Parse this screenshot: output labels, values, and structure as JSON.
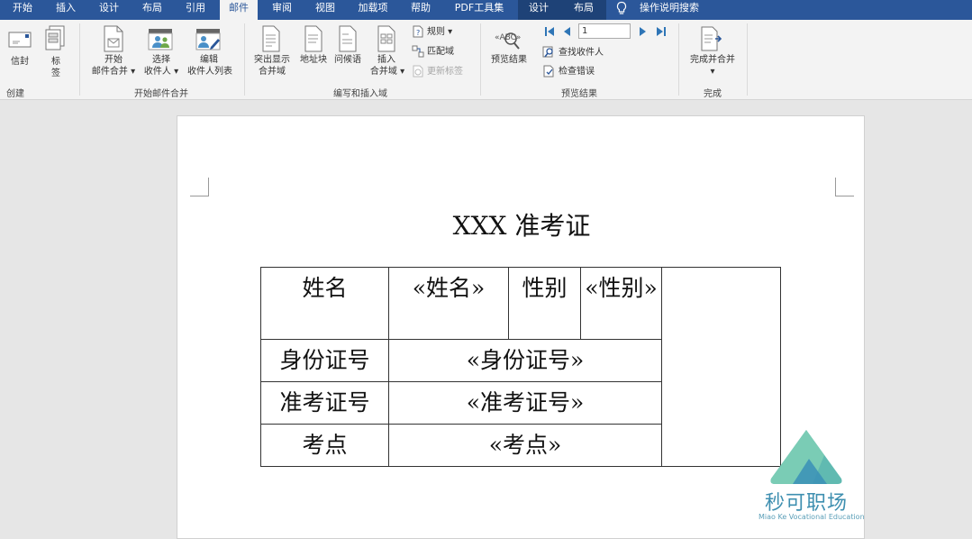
{
  "tabs": [
    "开始",
    "插入",
    "设计",
    "布局",
    "引用",
    "邮件",
    "审阅",
    "视图",
    "加载项",
    "帮助",
    "PDF工具集",
    "设计",
    "布局"
  ],
  "active_tab_index": 5,
  "tell_me": "操作说明搜索",
  "ribbon": {
    "create": {
      "label": "创建",
      "envelope": "信封",
      "labels_btn_1": "标",
      "labels_btn_2": "签"
    },
    "start_merge": {
      "label": "开始邮件合并",
      "start_1": "开始",
      "start_2": "邮件合并 ▾",
      "select_1": "选择",
      "select_2": "收件人 ▾",
      "edit_1": "编辑",
      "edit_2": "收件人列表"
    },
    "write_insert": {
      "label": "编写和插入域",
      "highlight_1": "突出显示",
      "highlight_2": "合并域",
      "address": "地址块",
      "greeting": "问候语",
      "insert_1": "插入",
      "insert_2": "合并域 ▾",
      "rules": "规则 ▾",
      "match": "匹配域",
      "update": "更新标签"
    },
    "preview": {
      "label": "预览结果",
      "preview_btn": "预览结果",
      "record": "1",
      "find": "查找收件人",
      "check": "检查错误"
    },
    "finish": {
      "label": "完成",
      "finish_btn": "完成并合并",
      "finish_arrow": "▾"
    }
  },
  "document": {
    "title": "XXX 准考证",
    "table": {
      "name_label": "姓名",
      "name_field": "«姓名»",
      "gender_label": "性别",
      "gender_field": "«性别»",
      "id_label": "身份证号",
      "id_field": "«身份证号»",
      "exam_label": "准考证号",
      "exam_field": "«准考证号»",
      "site_label": "考点",
      "site_field": "«考点»"
    }
  },
  "watermark": {
    "text": "秒可职场",
    "sub": "Miao Ke Vocational Education"
  },
  "colors": {
    "accent": "#2b579a",
    "ribbon_bg": "#f3f3f3",
    "nav_blue": "#2e75b6"
  }
}
